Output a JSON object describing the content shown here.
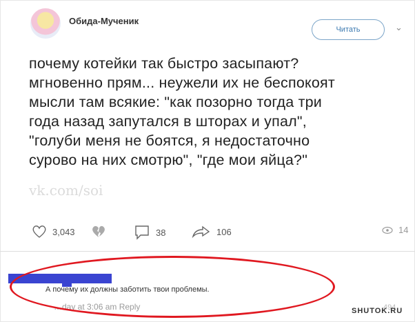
{
  "header": {
    "username": "Обида-Мученик",
    "follow_label": "Читать",
    "chevron_glyph": "⌄"
  },
  "tweet": {
    "lines": [
      "почему котейки так быстро засыпают?",
      "мгновенно прям... неужели их не беспокоят",
      "мысли там всякие: \"как позорно тогда три",
      "года назад запутался в шторах и упал\",",
      "\"голуби меня не боятся, я недостаточно",
      "сурово на них смотрю\", \"где мои яйца?\""
    ],
    "watermark": "vk.com/soi"
  },
  "actions": {
    "likes": "3,043",
    "comments": "38",
    "reposts": "106",
    "views": "14"
  },
  "reply": {
    "text": "А почему их должны заботить твои проблемы.",
    "meta": "…day at 3:06 am  Reply",
    "badge": "494"
  },
  "watermark_site": "SHUTOK.RU",
  "colors": {
    "oval": "#e01820",
    "redaction": "#3a44d1",
    "follow": "#3b79b0"
  }
}
